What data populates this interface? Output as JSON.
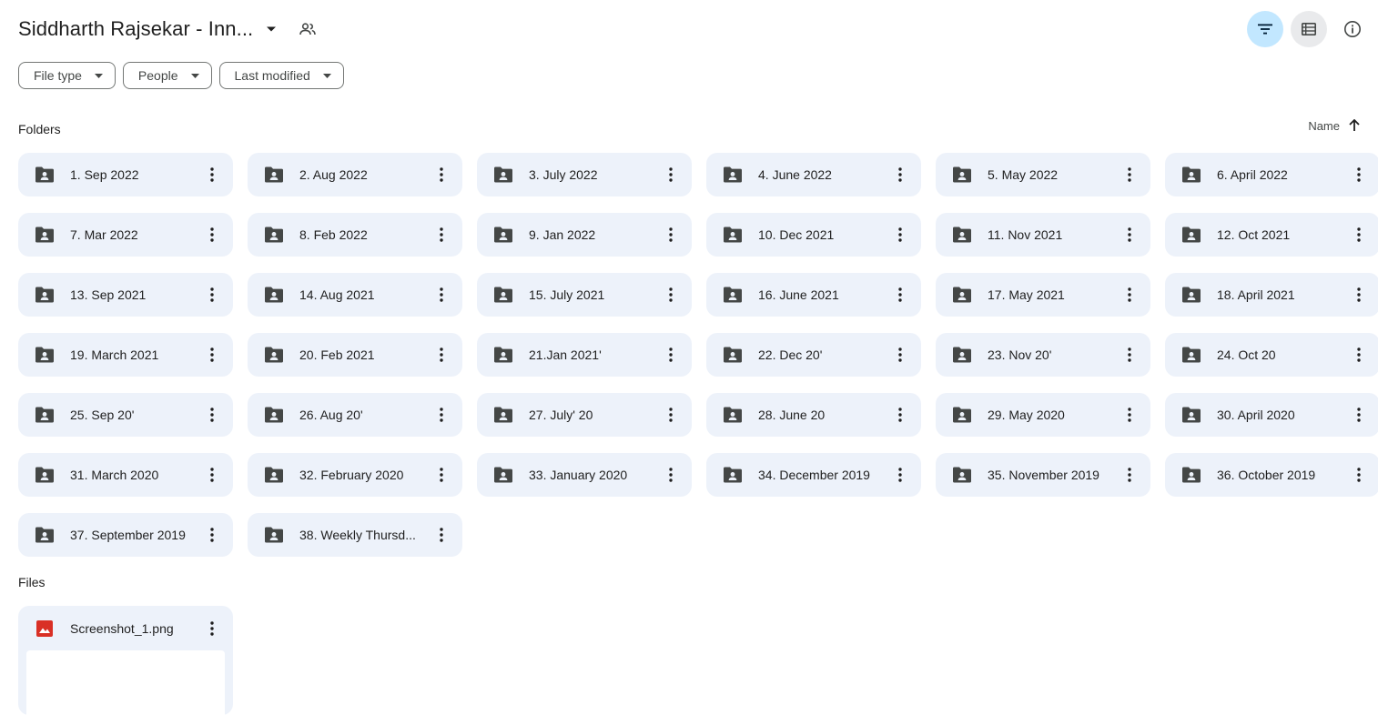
{
  "header": {
    "title": "Siddharth Rajsekar - Inn..."
  },
  "toolbar": {
    "filter_icon": "filter-icon",
    "list_view_icon": "list-view-icon",
    "info_icon": "info-icon"
  },
  "filters": [
    {
      "label": "File type"
    },
    {
      "label": "People"
    },
    {
      "label": "Last modified"
    }
  ],
  "sections": {
    "folders_label": "Folders",
    "files_label": "Files"
  },
  "sort": {
    "label": "Name",
    "direction_icon": "arrow-up-icon"
  },
  "folders": [
    {
      "name": "1. Sep 2022"
    },
    {
      "name": "2. Aug 2022"
    },
    {
      "name": "3. July 2022"
    },
    {
      "name": "4. June 2022"
    },
    {
      "name": "5. May 2022"
    },
    {
      "name": "6. April 2022"
    },
    {
      "name": "7. Mar 2022"
    },
    {
      "name": "8. Feb 2022"
    },
    {
      "name": "9. Jan 2022"
    },
    {
      "name": "10. Dec 2021"
    },
    {
      "name": "11. Nov 2021"
    },
    {
      "name": "12. Oct 2021"
    },
    {
      "name": "13. Sep 2021"
    },
    {
      "name": "14. Aug 2021"
    },
    {
      "name": "15. July 2021"
    },
    {
      "name": "16. June 2021"
    },
    {
      "name": "17. May 2021"
    },
    {
      "name": "18. April 2021"
    },
    {
      "name": "19. March 2021"
    },
    {
      "name": "20. Feb 2021"
    },
    {
      "name": "21.Jan 2021'"
    },
    {
      "name": "22. Dec 20'"
    },
    {
      "name": "23. Nov 20'"
    },
    {
      "name": "24. Oct 20"
    },
    {
      "name": "25. Sep 20'"
    },
    {
      "name": "26. Aug 20'"
    },
    {
      "name": "27. July' 20"
    },
    {
      "name": "28. June 20"
    },
    {
      "name": "29. May 2020"
    },
    {
      "name": "30. April 2020"
    },
    {
      "name": "31. March 2020"
    },
    {
      "name": "32. February 2020"
    },
    {
      "name": "33. January 2020"
    },
    {
      "name": "34. December 2019"
    },
    {
      "name": "35. November 2019"
    },
    {
      "name": "36. October 2019"
    },
    {
      "name": "37. September 2019"
    },
    {
      "name": "38. Weekly Thursd..."
    }
  ],
  "files": [
    {
      "name": "Screenshot_1.png",
      "icon": "image-file-icon"
    }
  ],
  "colors": {
    "accent_active": "#c2e7ff",
    "card_bg": "#edf2fa",
    "image_file_red": "#d93025"
  }
}
